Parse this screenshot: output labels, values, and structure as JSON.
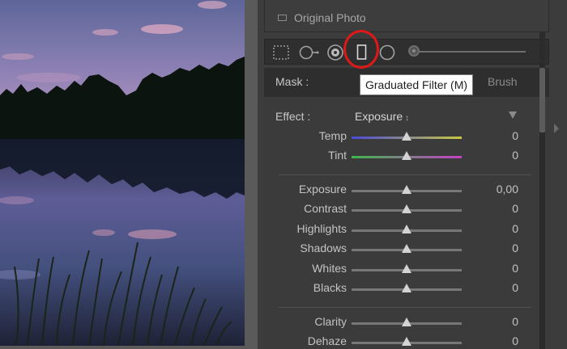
{
  "panel": {
    "original_photo_label": "Original Photo",
    "mask_label": "Mask :",
    "brush_label": "Brush",
    "tooltip": "Graduated Filter (M)",
    "tools": [
      "range-mask-icon",
      "spot-removal-icon",
      "red-eye-icon",
      "graduated-filter-icon",
      "radial-filter-icon"
    ],
    "effect_label": "Effect :",
    "effect_value": "Exposure",
    "effect_updown": "↕",
    "sliders_color": [
      {
        "label": "Temp",
        "value": "0",
        "level": 0.5
      },
      {
        "label": "Tint",
        "value": "0",
        "level": 0.5
      }
    ],
    "sliders_tone": [
      {
        "label": "Exposure",
        "value": "0,00",
        "level": 0.5
      },
      {
        "label": "Contrast",
        "value": "0",
        "level": 0.5
      },
      {
        "label": "Highlights",
        "value": "0",
        "level": 0.5
      },
      {
        "label": "Shadows",
        "value": "0",
        "level": 0.5
      },
      {
        "label": "Whites",
        "value": "0",
        "level": 0.5
      },
      {
        "label": "Blacks",
        "value": "0",
        "level": 0.5
      }
    ],
    "sliders_presence": [
      {
        "label": "Clarity",
        "value": "0",
        "level": 0.5
      },
      {
        "label": "Dehaze",
        "value": "0",
        "level": 0.5
      }
    ]
  },
  "colors": {
    "highlight_ring": "#e01818",
    "temp_gradient": [
      "#4a4ad8",
      "#c8c840"
    ],
    "tint_gradient": [
      "#3db84a",
      "#c640c8"
    ]
  }
}
